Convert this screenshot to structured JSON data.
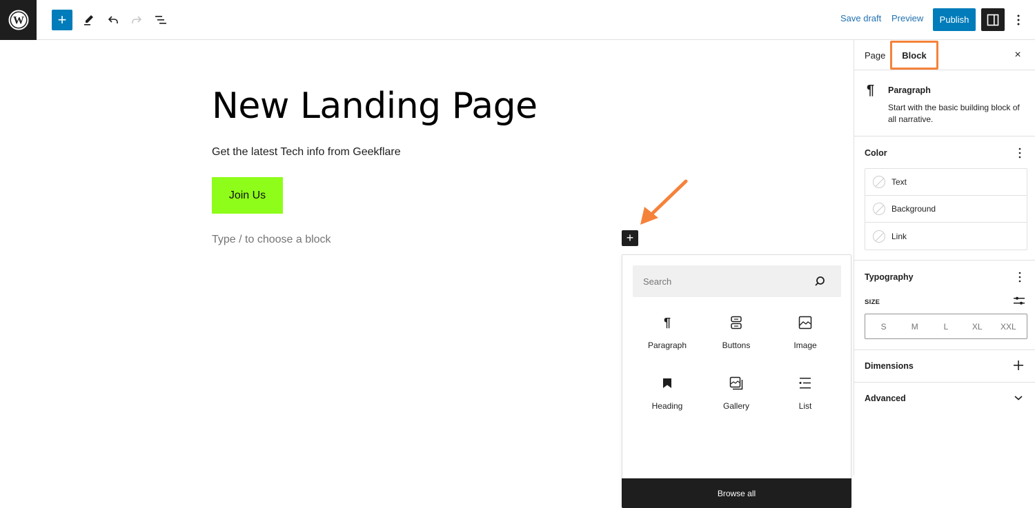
{
  "topbar": {
    "logo": "wordpress-logo",
    "add_block_label": "+",
    "tools": [
      "edit-tool-icon",
      "undo-icon",
      "redo-icon",
      "document-overview-icon"
    ],
    "save_draft": "Save draft",
    "preview": "Preview",
    "publish": "Publish",
    "accent": "#007cba"
  },
  "canvas": {
    "title": "New Landing Page",
    "paragraph": "Get the latest Tech info from Geekflare",
    "button_label": "Join Us",
    "button_color": "#8efd1a",
    "placeholder": "Type / to choose a block"
  },
  "inserter": {
    "search_placeholder": "Search",
    "blocks": [
      {
        "label": "Paragraph",
        "icon": "paragraph-icon"
      },
      {
        "label": "Buttons",
        "icon": "buttons-icon"
      },
      {
        "label": "Image",
        "icon": "image-icon"
      },
      {
        "label": "Heading",
        "icon": "heading-icon"
      },
      {
        "label": "Gallery",
        "icon": "gallery-icon"
      },
      {
        "label": "List",
        "icon": "list-icon"
      }
    ],
    "browse_all": "Browse all"
  },
  "annotation": {
    "highlight_color": "#f5823a"
  },
  "sidebar": {
    "tabs": [
      {
        "label": "Page",
        "active": false
      },
      {
        "label": "Block",
        "active": true
      }
    ],
    "close_icon": "×",
    "block_card": {
      "icon": "¶",
      "title": "Paragraph",
      "description": "Start with the basic building block of all narrative."
    },
    "color": {
      "title": "Color",
      "items": [
        "Text",
        "Background",
        "Link"
      ]
    },
    "typography": {
      "title": "Typography",
      "size_label": "SIZE",
      "sizes": [
        "S",
        "M",
        "L",
        "XL",
        "XXL"
      ]
    },
    "dimensions": {
      "title": "Dimensions"
    },
    "advanced": {
      "title": "Advanced"
    }
  }
}
